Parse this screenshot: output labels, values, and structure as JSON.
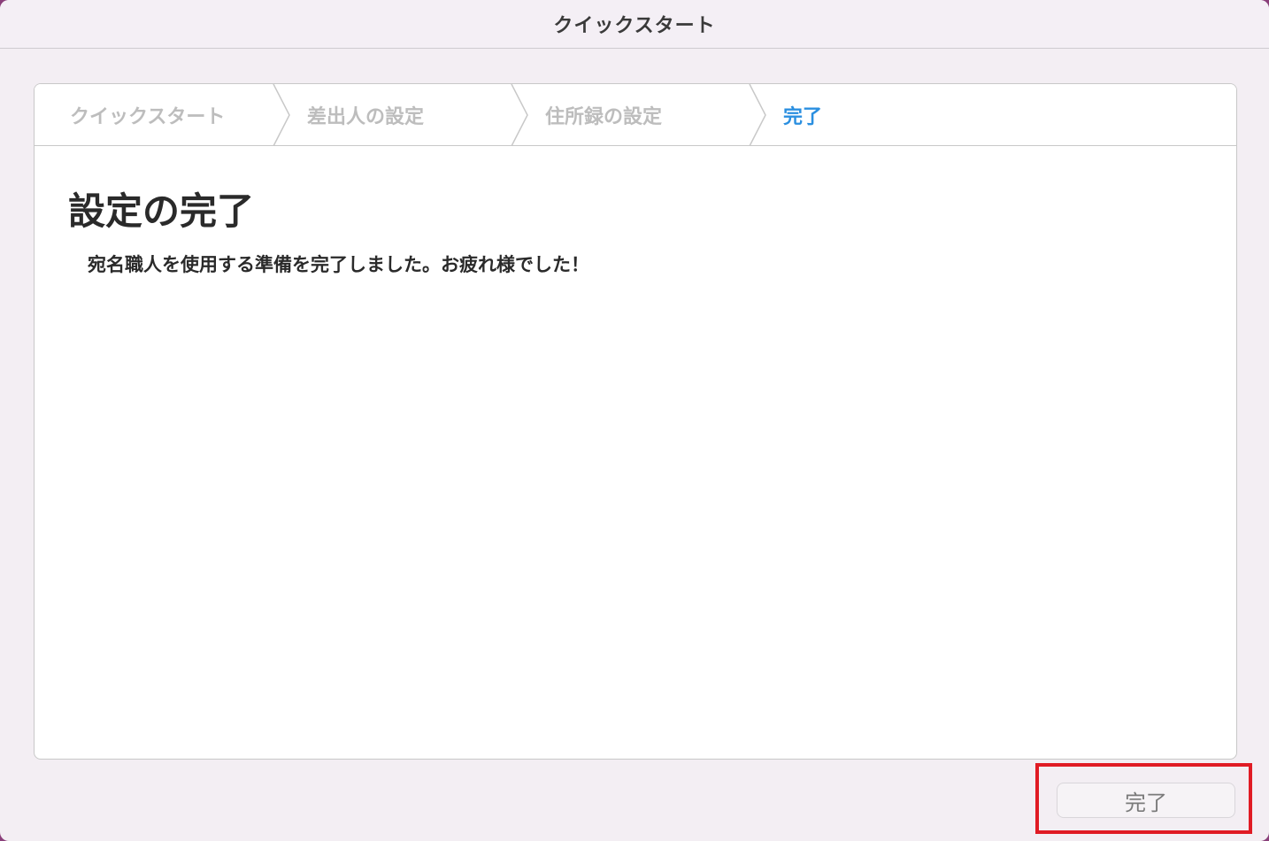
{
  "window": {
    "title": "クイックスタート"
  },
  "steps": [
    {
      "label": "クイックスタート",
      "state": "inactive"
    },
    {
      "label": "差出人の設定",
      "state": "inactive"
    },
    {
      "label": "住所録の設定",
      "state": "inactive"
    },
    {
      "label": "完了",
      "state": "active"
    }
  ],
  "content": {
    "heading": "設定の完了",
    "message": "宛名職人を使用する準備を完了しました。お疲れ様でした！"
  },
  "footer": {
    "finish_label": "完了"
  },
  "colors": {
    "active_step": "#2b8fe0",
    "inactive_step": "#bdbdbd",
    "highlight": "#e01b24"
  }
}
